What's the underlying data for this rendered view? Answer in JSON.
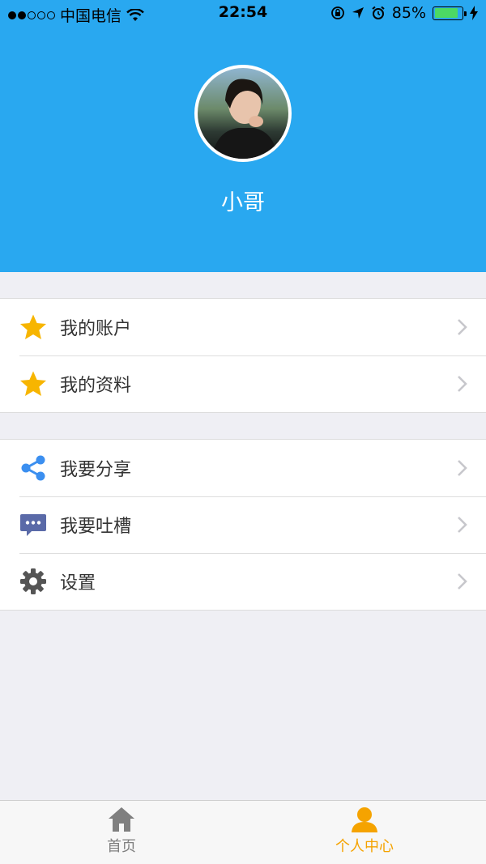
{
  "status_bar": {
    "carrier": "中国电信",
    "time": "22:54",
    "battery_percent": "85%",
    "battery_level": 0.85
  },
  "profile": {
    "name": "小哥"
  },
  "menu_group_1": [
    {
      "label": "我的账户",
      "icon": "star-icon"
    },
    {
      "label": "我的资料",
      "icon": "star-icon"
    }
  ],
  "menu_group_2": [
    {
      "label": "我要分享",
      "icon": "share-icon"
    },
    {
      "label": "我要吐槽",
      "icon": "chat-bubble-icon"
    },
    {
      "label": "设置",
      "icon": "gear-icon"
    }
  ],
  "tabbar": {
    "tabs": [
      {
        "label": "首页",
        "icon": "home-icon",
        "active": false
      },
      {
        "label": "个人中心",
        "icon": "person-icon",
        "active": true
      }
    ]
  },
  "colors": {
    "header_bg": "#29a8f0",
    "star": "#f7b500",
    "share": "#3b8ff0",
    "chat": "#5a6aa8",
    "gear": "#555555",
    "active_tab": "#f5a300",
    "inactive_tab": "#7f7f7f"
  }
}
